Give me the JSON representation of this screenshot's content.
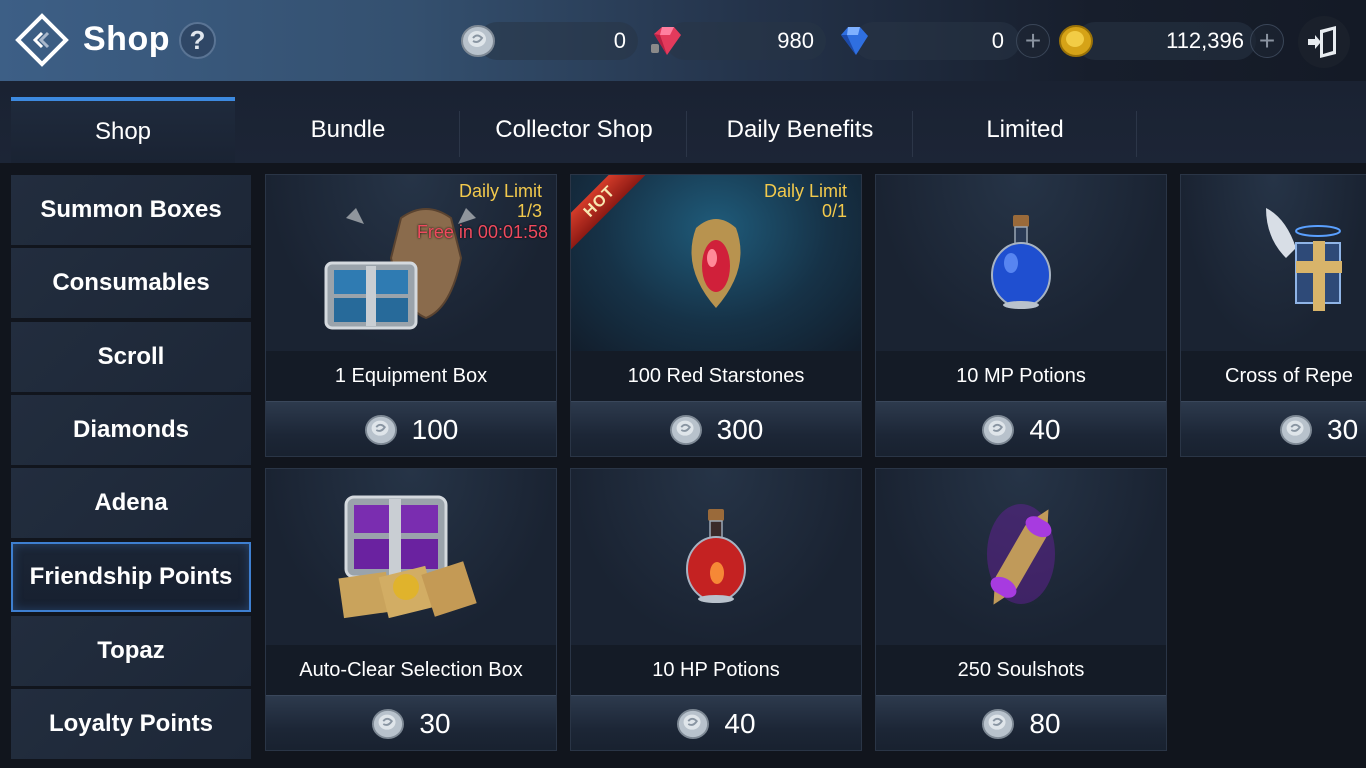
{
  "header": {
    "title": "Shop",
    "help": "?",
    "currencies": [
      {
        "name": "silver-coin",
        "amount": "0"
      },
      {
        "name": "red-diamond",
        "amount": "980"
      },
      {
        "name": "blue-diamond",
        "amount": "0"
      },
      {
        "name": "adena",
        "amount": "112,396"
      }
    ],
    "plus": "+"
  },
  "tabs": [
    {
      "label": "Shop",
      "active": true
    },
    {
      "label": "Bundle"
    },
    {
      "label": "Collector Shop"
    },
    {
      "label": "Daily Benefits"
    },
    {
      "label": "Limited"
    }
  ],
  "sidebar": [
    {
      "label": "Summon Boxes"
    },
    {
      "label": "Consumables"
    },
    {
      "label": "Scroll"
    },
    {
      "label": "Diamonds"
    },
    {
      "label": "Adena"
    },
    {
      "label": "Friendship Points",
      "active": true
    },
    {
      "label": "Topaz"
    },
    {
      "label": "Loyalty Points"
    }
  ],
  "items": [
    {
      "name": "1 Equipment Box",
      "price": "100",
      "limit_label": "Daily Limit",
      "limit": "1/3",
      "free_timer": "Free in 00:01:58"
    },
    {
      "name": "100 Red Starstones",
      "price": "300",
      "limit_label": "Daily Limit",
      "limit": "0/1",
      "badge": "HOT"
    },
    {
      "name": "10 MP Potions",
      "price": "40"
    },
    {
      "name": "Cross of Repe",
      "price": "30"
    },
    {
      "name": "Auto-Clear Selection Box",
      "price": "30"
    },
    {
      "name": "10 HP Potions",
      "price": "40"
    },
    {
      "name": "250 Soulshots",
      "price": "80"
    }
  ],
  "colors": {
    "accent": "#3d8ae0",
    "limit": "#f2c94c",
    "timer": "#ef4a5e"
  }
}
